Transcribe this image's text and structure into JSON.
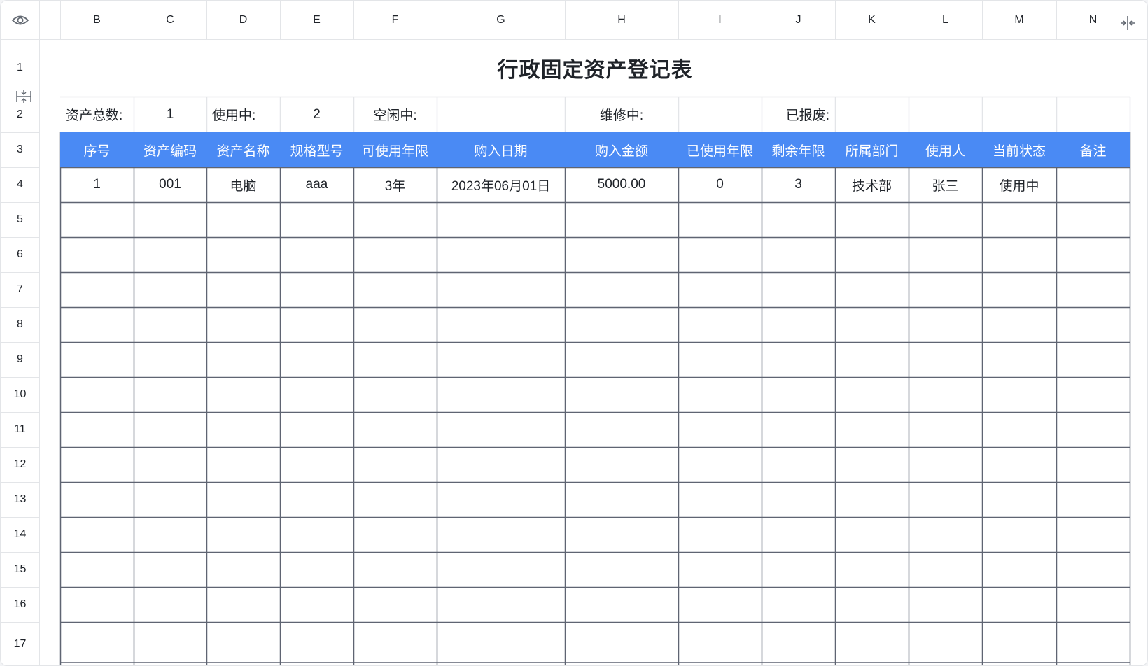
{
  "app": {
    "corner_icon": "eye-icon",
    "freeze_icon": "freeze-columns-icon",
    "row_resize_icon": "row-resize-icon"
  },
  "colors": {
    "header_blue": "#4a8af4",
    "grid": "#5f6472",
    "light_grid": "#e3e5e8"
  },
  "column_headers": [
    "B",
    "C",
    "D",
    "E",
    "F",
    "G",
    "H",
    "I",
    "J",
    "K",
    "L",
    "M",
    "N"
  ],
  "row_headers": [
    "1",
    "2",
    "3",
    "4",
    "5",
    "6",
    "7",
    "8",
    "9",
    "10",
    "11",
    "12",
    "13",
    "14",
    "15",
    "16",
    "17"
  ],
  "title": "行政固定资产登记表",
  "summary": {
    "total_label": "资产总数:",
    "total_value": "1",
    "in_use_label": "使用中:",
    "in_use_value": "2",
    "idle_label": "空闲中:",
    "idle_value": "",
    "repair_label": "维修中:",
    "repair_value": "",
    "scrapped_label": "已报废:",
    "scrapped_value": ""
  },
  "table": {
    "headers": [
      "序号",
      "资产编码",
      "资产名称",
      "规格型号",
      "可使用年限",
      "购入日期",
      "购入金额",
      "已使用年限",
      "剩余年限",
      "所属部门",
      "使用人",
      "当前状态",
      "备注"
    ],
    "rows": [
      [
        "1",
        "001",
        "电脑",
        "aaa",
        "3年",
        "2023年06月01日",
        "5000.00",
        "0",
        "3",
        "技术部",
        "张三",
        "使用中",
        ""
      ]
    ]
  }
}
